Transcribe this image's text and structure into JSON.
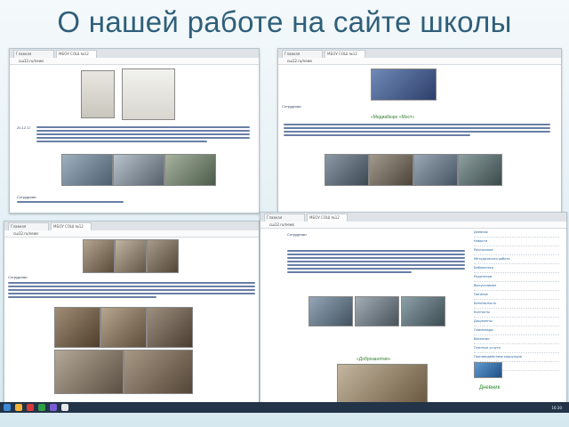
{
  "title": "О нашей работе на сайте школы",
  "windows": [
    {
      "tab1": "Главная",
      "tab2": "МБОУ СОШ №12",
      "address": "сш12.ru/news",
      "caption": "Сотрудники",
      "paragraph_label": "20.12.17"
    },
    {
      "tab1": "Главная",
      "tab2": "МБОУ СОШ №12",
      "address": "сш12.ru/news",
      "heading": "«Медиабюро «Мост»",
      "caption": "Сотрудники"
    },
    {
      "tab1": "Главная",
      "tab2": "МБОУ СОШ №12",
      "address": "сш12.ru/news",
      "caption": "Сотрудники"
    },
    {
      "tab1": "Главная",
      "tab2": "МБОУ СОШ №12",
      "address": "сш12.ru/news",
      "heading": "«Доброзанятие»",
      "caption": "Сотрудники",
      "sidebar": [
        "Дневник",
        "Новости",
        "Расписание",
        "Методическая работа",
        "Библиотека",
        "Родителям",
        "Выпускникам",
        "Питание",
        "Безопасность",
        "Контакты",
        "Документы",
        "Олимпиады",
        "Вакансии",
        "Платные услуги",
        "Противодействие коррупции",
        "Поступающим"
      ],
      "logo_label": "Дневник"
    }
  ],
  "taskbar": {
    "time": "16:30"
  }
}
